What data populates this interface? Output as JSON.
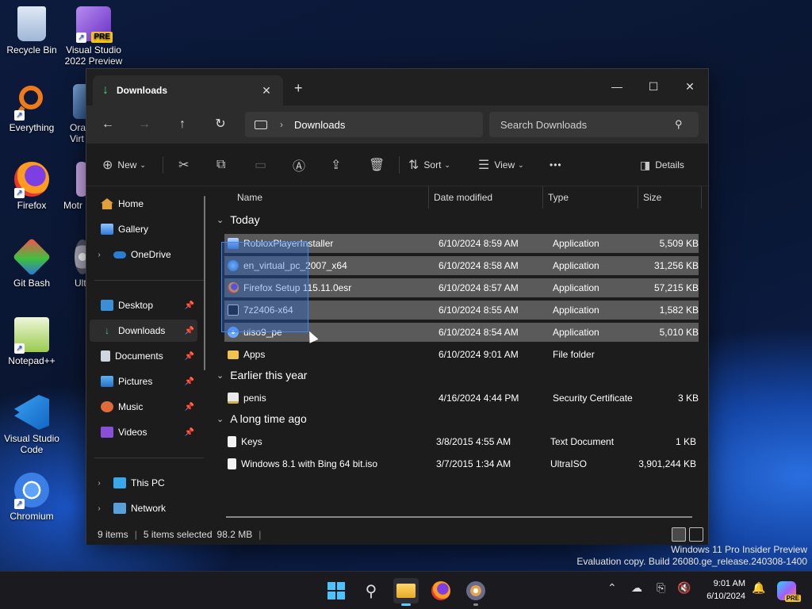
{
  "desktop": {
    "icons": [
      {
        "label": "Recycle Bin"
      },
      {
        "label": "Visual Studio 2022 Preview"
      },
      {
        "label": "Everything"
      },
      {
        "label": "Ora Virt"
      },
      {
        "label": "Firefox"
      },
      {
        "label": "Motr"
      },
      {
        "label": "Git Bash"
      },
      {
        "label": "Ult"
      },
      {
        "label": "Notepad++"
      },
      {
        "label": "Visual Studio Code"
      },
      {
        "label": "Chromium"
      }
    ],
    "vs_badge": "PRE"
  },
  "window": {
    "tab_title": "Downloads",
    "new_tab": "+",
    "address": {
      "current": "Downloads"
    },
    "search": {
      "placeholder": "Search Downloads"
    },
    "commands": {
      "new": "New",
      "sort": "Sort",
      "view": "View",
      "more": "•••",
      "details": "Details"
    },
    "nav": [
      {
        "label": "Home"
      },
      {
        "label": "Gallery"
      },
      {
        "label": "OneDrive"
      },
      {
        "label": "Desktop"
      },
      {
        "label": "Downloads"
      },
      {
        "label": "Documents"
      },
      {
        "label": "Pictures"
      },
      {
        "label": "Music"
      },
      {
        "label": "Videos"
      },
      {
        "label": "This PC"
      },
      {
        "label": "Network"
      }
    ],
    "columns": {
      "name": "Name",
      "date": "Date modified",
      "type": "Type",
      "size": "Size"
    },
    "groups": [
      {
        "label": "Today"
      },
      {
        "label": "Earlier this year"
      },
      {
        "label": "A long time ago"
      }
    ],
    "files": [
      {
        "name": "RobloxPlayerInstaller",
        "date": "6/10/2024 8:59 AM",
        "type": "Application",
        "size": "5,509 KB",
        "selected": true
      },
      {
        "name": "en_virtual_pc_2007_x64",
        "date": "6/10/2024 8:58 AM",
        "type": "Application",
        "size": "31,256 KB",
        "selected": true
      },
      {
        "name": "Firefox Setup 115.11.0esr",
        "date": "6/10/2024 8:57 AM",
        "type": "Application",
        "size": "57,215 KB",
        "selected": true
      },
      {
        "name": "7z2406-x64",
        "date": "6/10/2024 8:55 AM",
        "type": "Application",
        "size": "1,582 KB",
        "selected": true
      },
      {
        "name": "uiso9_pe",
        "date": "6/10/2024 8:54 AM",
        "type": "Application",
        "size": "5,010 KB",
        "selected": true
      },
      {
        "name": "Apps",
        "date": "6/10/2024 9:01 AM",
        "type": "File folder",
        "size": "",
        "selected": false
      },
      {
        "name": "penis",
        "date": "4/16/2024 4:44 PM",
        "type": "Security Certificate",
        "size": "3 KB",
        "selected": false
      },
      {
        "name": "Keys",
        "date": "3/8/2015 4:55 AM",
        "type": "Text Document",
        "size": "1 KB",
        "selected": false
      },
      {
        "name": "Windows 8.1 with Bing 64 bit.iso",
        "date": "3/7/2015 1:34 AM",
        "type": "UltraISO",
        "size": "3,901,244 KB",
        "selected": false
      }
    ],
    "status": {
      "items": "9 items",
      "selected": "5 items selected",
      "size": "98.2 MB"
    }
  },
  "watermark": {
    "line1": "Windows 11 Pro Insider Preview",
    "line2": "Evaluation copy. Build 26080.ge_release.240308-1400"
  },
  "taskbar": {
    "time": "9:01 AM",
    "date": "6/10/2024",
    "copilot_badge": "PRE"
  },
  "colors": {
    "accent": "#60cdff",
    "selection": "#5a5a5a",
    "folder": "#f2c14e"
  }
}
